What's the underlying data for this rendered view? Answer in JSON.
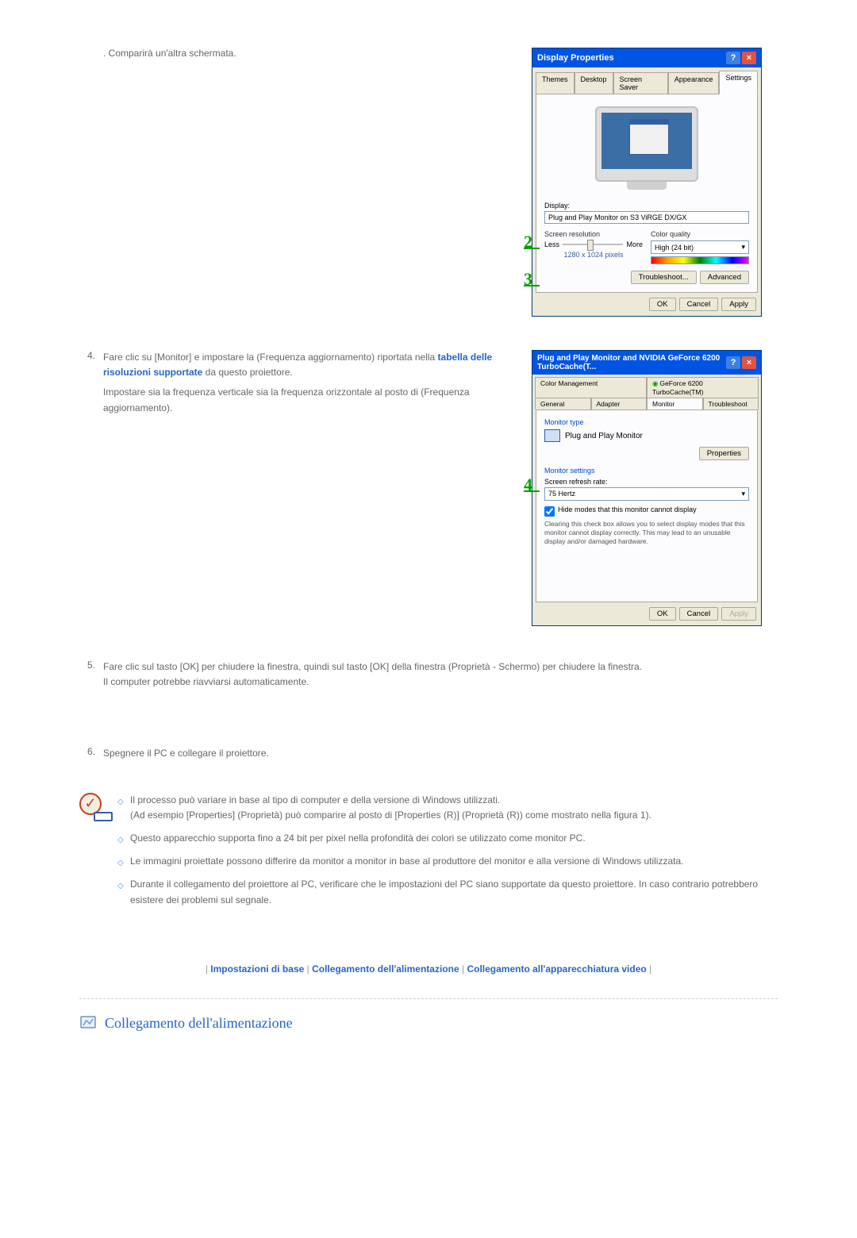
{
  "step3_add": ". Comparirà un'altra schermata.",
  "dialog1": {
    "title": "Display Properties",
    "tabs": [
      "Themes",
      "Desktop",
      "Screen Saver",
      "Appearance",
      "Settings"
    ],
    "activeTab": "Settings",
    "display_label": "Display:",
    "display_name": "Plug and Play Monitor on S3 ViRGE DX/GX",
    "screen_res_label": "Screen resolution",
    "less": "Less",
    "more": "More",
    "res_text": "1280 x 1024 pixels",
    "color_quality_label": "Color quality",
    "color_select": "High (24 bit)",
    "troubleshoot": "Troubleshoot...",
    "advanced": "Advanced",
    "ok": "OK",
    "cancel": "Cancel",
    "apply": "Apply"
  },
  "callouts": {
    "c2": "2",
    "c3": "3",
    "c4": "4"
  },
  "step4": {
    "num": "4.",
    "text1a": "Fare clic su [Monitor] e impostare la (Frequenza aggiornamento) riportata nella ",
    "text1_link": "tabella delle risoluzioni supportate",
    "text1b": " da questo proiettore.",
    "text2": "Impostare sia la frequenza verticale sia la frequenza orizzontale al posto di (Frequenza aggiornamento)."
  },
  "dialog2": {
    "title": "Plug and Play Monitor and NVIDIA GeForce 6200 TurboCache(T...",
    "tabs_row1": [
      "Color Management",
      "GeForce 6200 TurboCache(TM)"
    ],
    "tabs_row2": [
      "General",
      "Adapter",
      "Monitor",
      "Troubleshoot"
    ],
    "activeTab": "Monitor",
    "monitor_type": "Monitor type",
    "monitor_name": "Plug and Play Monitor",
    "properties_btn": "Properties",
    "monitor_settings": "Monitor settings",
    "screen_refresh_label": "Screen refresh rate:",
    "refresh_value": "75 Hertz",
    "hide_modes": "Hide modes that this monitor cannot display",
    "hide_desc": "Clearing this check box allows you to select display modes that this monitor cannot display correctly. This may lead to an unusable display and/or damaged hardware.",
    "ok": "OK",
    "cancel": "Cancel",
    "apply": "Apply"
  },
  "step5": {
    "num": "5.",
    "line1": "Fare clic sul tasto [OK] per chiudere la finestra, quindi sul tasto [OK] della finestra (Proprietà - Schermo) per chiudere la finestra.",
    "line2": "Il computer potrebbe riavviarsi automaticamente."
  },
  "step6": {
    "num": "6.",
    "text": "Spegnere il PC e collegare il proiettore."
  },
  "notes": {
    "n1a": "Il processo può variare in base al tipo di computer e della versione di Windows utilizzati.",
    "n1b": "(Ad esempio [Properties] (Proprietà) può comparire al posto di [Properties (R)] (Proprietà (R)) come mostrato nella figura 1).",
    "n2": "Questo apparecchio supporta fino a 24 bit per pixel nella profondità dei colori se utilizzato come monitor PC.",
    "n3": "Le immagini proiettate possono differire da monitor a monitor in base al produttore del monitor e alla versione di Windows utilizzata.",
    "n4": "Durante il collegamento del proiettore al PC, verificare che le impostazioni del PC siano supportate da questo proiettore. In caso contrario potrebbero esistere dei problemi sul segnale."
  },
  "bottom_links": {
    "link1": "Impostazioni di base",
    "link2": "Collegamento dell'alimentazione",
    "link3": "Collegamento all'apparecchiatura video"
  },
  "section_header": "Collegamento dell'alimentazione"
}
